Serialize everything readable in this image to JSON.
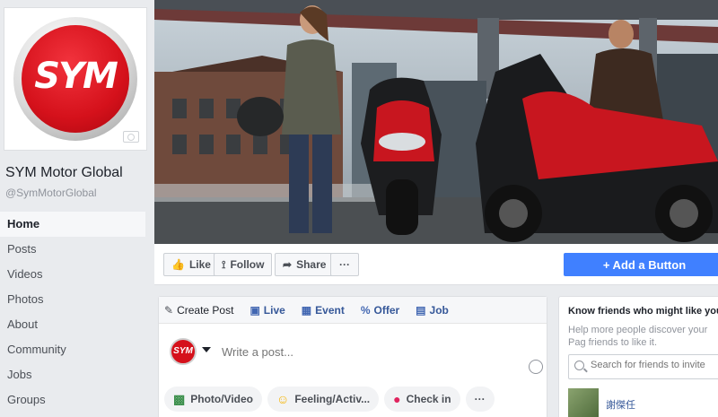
{
  "page": {
    "name": "SYM Motor Global",
    "handle": "@SymMotorGlobal",
    "logo_text": "SYM",
    "brand_colors": {
      "red": "#d5111b",
      "facebook_blue": "#4267b2",
      "button_blue": "#4080ff"
    }
  },
  "sidebar": {
    "items": [
      {
        "label": "Home",
        "active": true
      },
      {
        "label": "Posts"
      },
      {
        "label": "Videos"
      },
      {
        "label": "Photos"
      },
      {
        "label": "About"
      },
      {
        "label": "Community"
      },
      {
        "label": "Jobs"
      },
      {
        "label": "Groups"
      }
    ]
  },
  "actions": {
    "like": "Like",
    "follow": "Follow",
    "share": "Share",
    "more": "···",
    "add_button": "+ Add a Button"
  },
  "composer": {
    "tabs": [
      {
        "label": "Create Post",
        "icon": "pencil-icon"
      },
      {
        "label": "Live",
        "icon": "live-video-icon"
      },
      {
        "label": "Event",
        "icon": "calendar-icon"
      },
      {
        "label": "Offer",
        "icon": "offer-tag-icon"
      },
      {
        "label": "Job",
        "icon": "briefcase-icon"
      }
    ],
    "placeholder": "Write a post...",
    "avatar_text": "SYM",
    "bottom": [
      {
        "label": "Photo/Video",
        "icon": "photo-icon"
      },
      {
        "label": "Feeling/Activ...",
        "icon": "smiley-icon"
      },
      {
        "label": "Check in",
        "icon": "map-pin-icon"
      },
      {
        "label": "···"
      }
    ]
  },
  "invite_card": {
    "title": "Know friends who might like your",
    "subtitle": "Help more people discover your Pag friends to like it.",
    "search_placeholder": "Search for friends to invite",
    "friend_name": "謝傑任"
  }
}
